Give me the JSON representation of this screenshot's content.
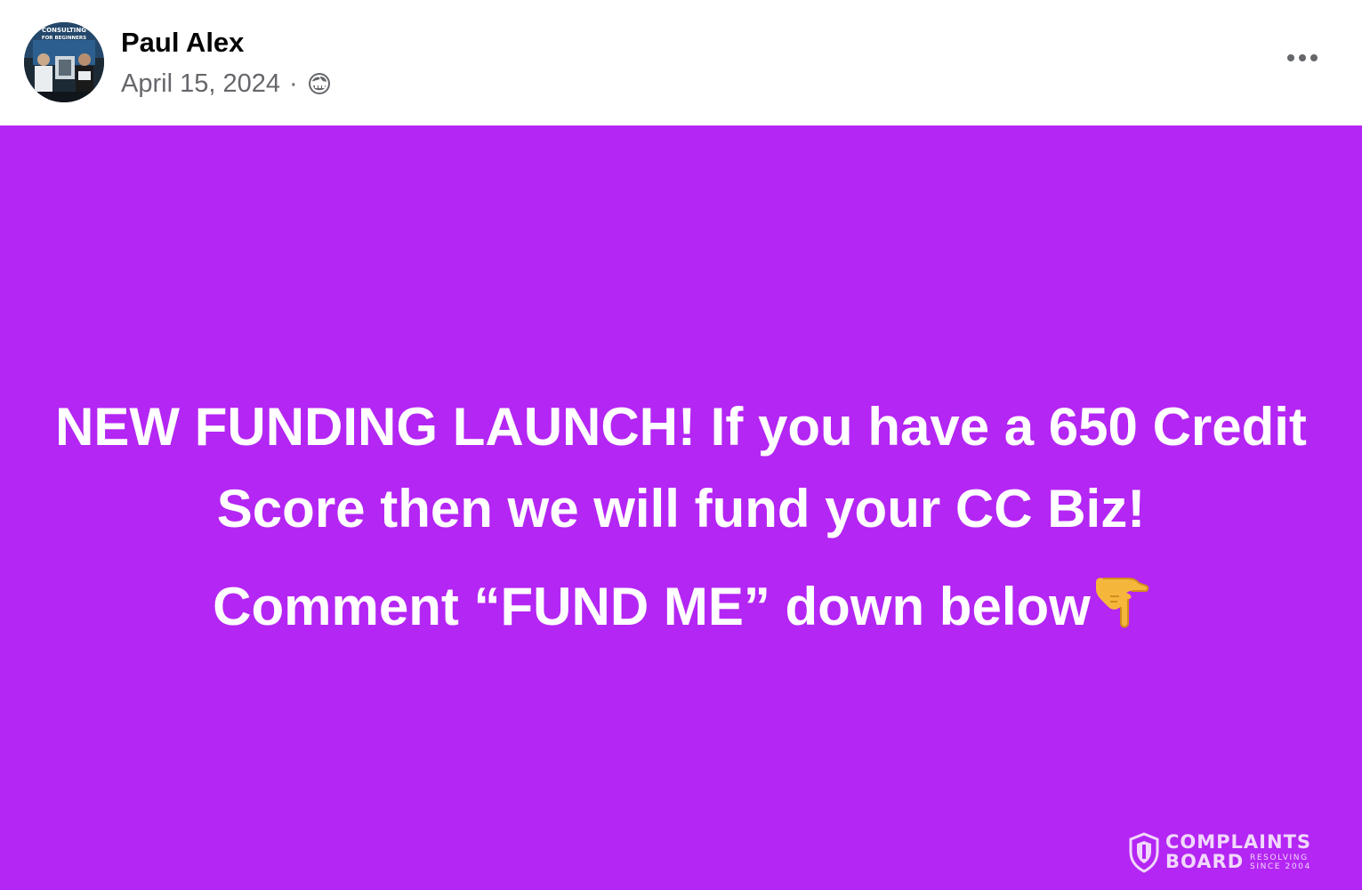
{
  "post": {
    "author_name": "Paul Alex",
    "date": "April 15, 2024",
    "separator": "·",
    "audience_icon": "public-globe-icon",
    "more_icon": "more-options-icon",
    "background_color": "#b426f3",
    "text_color": "#ffffff",
    "message_line1": "NEW FUNDING LAUNCH! If you have a 650 Credit Score then we will fund your CC Biz!",
    "message_line2": "Comment “FUND ME” down below",
    "emoji": "pointing-down-hand-emoji"
  },
  "avatar": {
    "banner_text_top": "CONSULTING",
    "banner_text_bottom": "FOR BEGINNERS"
  },
  "watermark": {
    "line1": "COMPLAINTS",
    "line2": "BOARD",
    "tag1": "RESOLVING",
    "tag2": "SINCE 2004"
  }
}
